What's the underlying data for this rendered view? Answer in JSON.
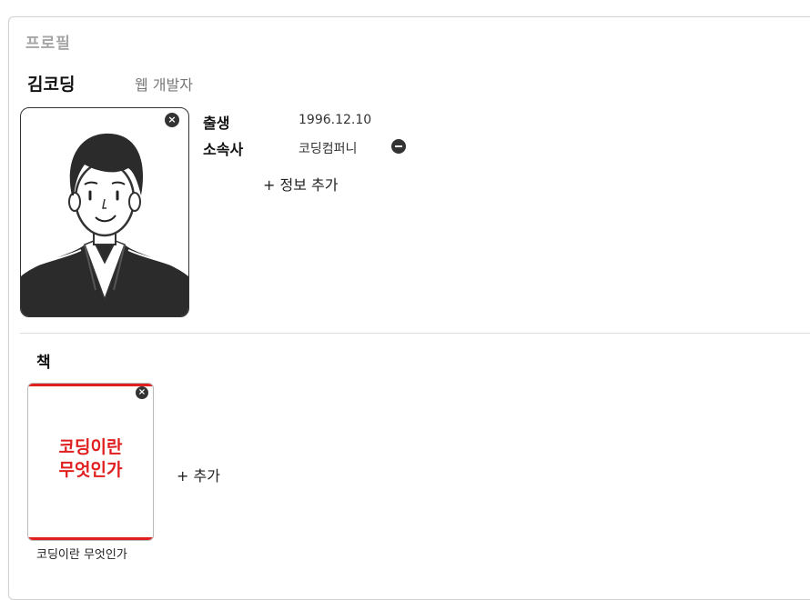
{
  "profile": {
    "section_label": "프로필",
    "name": "김코딩",
    "job": "웹 개발자",
    "photo_remove_icon": "×",
    "info": [
      {
        "key": "출생",
        "value": "1996.12.10"
      },
      {
        "key": "소속사",
        "value": "코딩컴퍼니"
      }
    ],
    "add_info_label": "+ 정보 추가"
  },
  "books": {
    "section_label": "책",
    "items": [
      {
        "cover_line1": "코딩이란",
        "cover_line2": "무엇인가",
        "caption": "코딩이란 무엇인가",
        "remove_icon": "×"
      }
    ],
    "add_label": "+ 추가"
  },
  "colors": {
    "accent": "#e02020",
    "icon_dark": "#333333"
  }
}
